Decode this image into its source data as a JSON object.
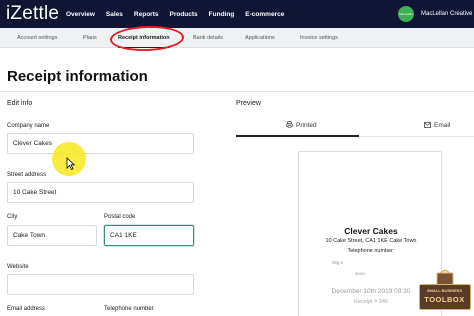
{
  "app": {
    "logo": "iZettle"
  },
  "nav": {
    "items": [
      "Overview",
      "Sales",
      "Reports",
      "Products",
      "Funding",
      "E-commerce"
    ],
    "account": "MacLellan Creative",
    "avatar_text": "MacLellan Creative"
  },
  "subtabs": {
    "items": [
      "Account settings",
      "Plans",
      "Receipt information",
      "Bank details",
      "Applications",
      "Invoice settings"
    ],
    "active": "Receipt information"
  },
  "page": {
    "title": "Receipt information"
  },
  "form": {
    "section": "Edit info",
    "company_name": {
      "label": "Company name",
      "value": "Clever Cakes"
    },
    "street": {
      "label": "Street address",
      "value": "10 Cake Street"
    },
    "city": {
      "label": "City",
      "value": "Cake Town"
    },
    "postal": {
      "label": "Postal code",
      "value": "CA1 1KE"
    },
    "website": {
      "label": "Website",
      "value": ""
    },
    "email": {
      "label": "Email address"
    },
    "phone": {
      "label": "Telephone number"
    }
  },
  "preview": {
    "section": "Preview",
    "tabs": [
      "Printed",
      "Email"
    ],
    "active_tab": "Printed",
    "receipt": {
      "company": "Clever Cakes",
      "address": "10 Cake Street, CA1 1KE Cake Town",
      "phone": "Telephone number:",
      "org": "Org n",
      "web": "www.",
      "date": "December 10th 2019 09:30",
      "number": "Receipt # 346"
    }
  },
  "overlay": {
    "badge_line1": "SMALL BUSINESS",
    "badge_line2": "TOOLBOX"
  },
  "colors": {
    "nav_bg": "#0f1533",
    "highlight_circle": "#e31e2a",
    "focus_border": "#3a8c7f",
    "cursor_highlight": "#f7e81c"
  }
}
